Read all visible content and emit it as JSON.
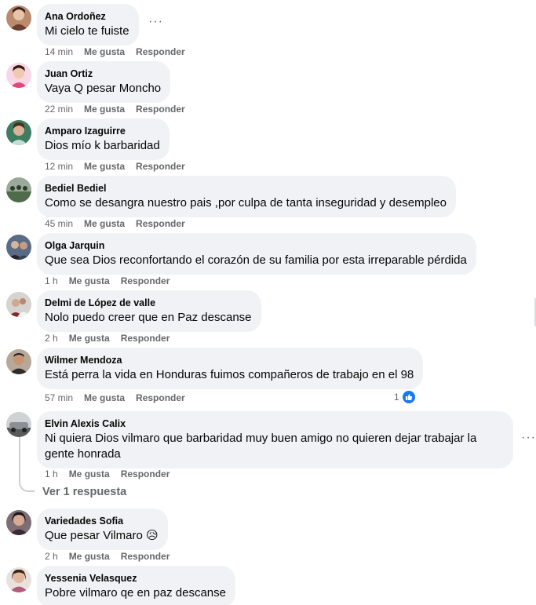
{
  "comments": [
    {
      "author": "Ana Ordoñez",
      "text": "Mi cielo te fuiste",
      "time": "14 min",
      "like": "Me gusta",
      "reply": "Responder"
    },
    {
      "author": "Juan Ortiz",
      "text": "Vaya Q pesar Moncho",
      "time": "22 min",
      "like": "Me gusta",
      "reply": "Responder"
    },
    {
      "author": "Amparo Izaguirre",
      "text": "Dios mío k barbaridad",
      "time": "12 min",
      "like": "Me gusta",
      "reply": "Responder"
    },
    {
      "author": "Bediel Bediel",
      "text": "Como se desangra nuestro pais ,por culpa de tanta inseguridad y desempleo",
      "time": "45 min",
      "like": "Me gusta",
      "reply": "Responder"
    },
    {
      "author": "Olga Jarquin",
      "text": "Que sea Dios reconfortando el corazón de su familia por esta irreparable pérdida",
      "time": "1 h",
      "like": "Me gusta",
      "reply": "Responder"
    },
    {
      "author": "Delmi de López de valle",
      "text": "Nolo puedo creer que en Paz descanse",
      "time": "2 h",
      "like": "Me gusta",
      "reply": "Responder"
    },
    {
      "author": "Wilmer Mendoza",
      "text": "Está perra la vida en Honduras fuimos compañeros de trabajo en el 98",
      "time": "57 min",
      "like": "Me gusta",
      "reply": "Responder",
      "reactions": "1"
    },
    {
      "author": "Elvin Alexis Calix",
      "text": "Ni quiera Dios vilmaro que barbaridad muy buen amigo no quieren dejar trabajar la gente honrada",
      "time": "1 h",
      "like": "Me gusta",
      "reply": "Responder"
    },
    {
      "author": "Variedades Sofia",
      "text": "Que pesar Vilmaro",
      "emoji": "😥",
      "time": "2 h",
      "like": "Me gusta",
      "reply": "Responder"
    },
    {
      "author": "Yessenia Velasquez",
      "text": "Pobre vilmaro qe en paz descanse",
      "time": "",
      "like": "",
      "reply": ""
    }
  ],
  "view_replies": "Ver 1 respuesta",
  "more_options": "···",
  "colors": {
    "bubble": "#f0f2f5",
    "meta": "#65676b",
    "like_blue": "#1877f2"
  },
  "icons": {
    "more": "three-dots-icon",
    "reaction": "thumbs-up-icon"
  }
}
